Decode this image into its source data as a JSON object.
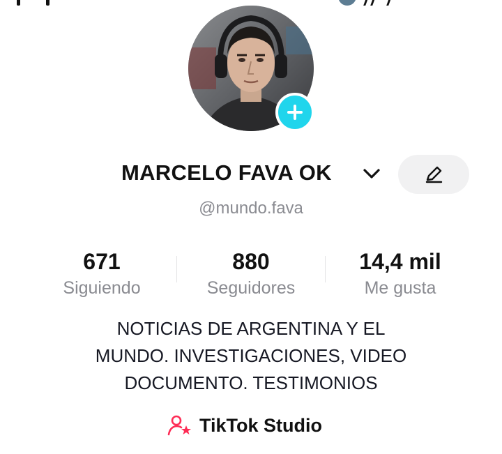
{
  "profile": {
    "display_name": "MARCELO FAVA OK",
    "handle": "@mundo.fava"
  },
  "stats": [
    {
      "value": "671",
      "label": "Siguiendo"
    },
    {
      "value": "880",
      "label": "Seguidores"
    },
    {
      "value": "14,4 mil",
      "label": "Me gusta"
    }
  ],
  "bio": {
    "lines": [
      "NOTICIAS DE ARGENTINA Y EL",
      "MUNDO. INVESTIGACIONES, VIDEO",
      "DOCUMENTO. TESTIMONIOS"
    ]
  },
  "studio": {
    "label": "TikTok Studio",
    "icon": "creator-star-icon"
  },
  "icons": {
    "add": "plus-icon",
    "chevron": "chevron-down-icon",
    "edit": "pencil-icon"
  },
  "colors": {
    "add_button": "#20d5ec",
    "studio_icon": "#fe2c55",
    "secondary_text": "#8a8b91",
    "edit_button_bg": "#f1f1f2"
  }
}
